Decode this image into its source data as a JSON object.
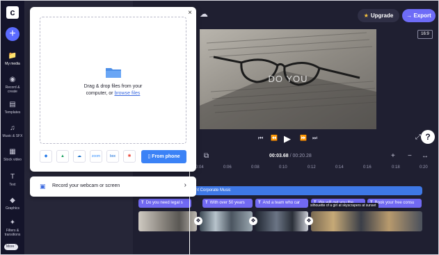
{
  "app": {
    "logo_letter": "c"
  },
  "sidebar": {
    "add_label": "+",
    "items": [
      {
        "label": "My media",
        "icon": "folder-icon"
      },
      {
        "label": "Record & create",
        "icon": "record-icon"
      },
      {
        "label": "Templates",
        "icon": "templates-icon"
      },
      {
        "label": "Music & SFX",
        "icon": "music-icon"
      },
      {
        "label": "Stock video",
        "icon": "film-icon"
      },
      {
        "label": "Text",
        "icon": "text-icon"
      },
      {
        "label": "Graphics",
        "icon": "shapes-icon"
      },
      {
        "label": "Filters & transitions",
        "icon": "wand-icon"
      }
    ],
    "more_label": "More"
  },
  "topbar": {
    "upgrade_label": "Upgrade",
    "export_label": "Export",
    "aspect_ratio": "16:9"
  },
  "preview": {
    "overlay_text": "DO YOU"
  },
  "timeline": {
    "current_time": "00:03.68",
    "separator": " / ",
    "total_time": "00:20.28",
    "ruler": [
      "0:04",
      "0:06",
      "0:08",
      "0:10",
      "0:12",
      "0:14",
      "0:16",
      "0:18",
      "0:20"
    ],
    "audio_track_label": "nt Corporate Music",
    "text_clips": [
      {
        "marker": "T",
        "label": "Do you need legal s"
      },
      {
        "marker": "T",
        "label": "With over 50 years"
      },
      {
        "marker": "T",
        "label": "And a team who car"
      },
      {
        "marker": "T",
        "label": "We will get you the"
      },
      {
        "marker": "T",
        "label": "Book your free consu"
      }
    ],
    "tooltip": "silhouette of a girl at skyscrapers at sunset"
  },
  "upload": {
    "close_label": "×",
    "drop_line1": "Drag & drop files from your",
    "drop_line2_prefix": "computer, or ",
    "browse_link": "browse files",
    "sources": [
      {
        "name": "dropbox-icon",
        "text": "◆"
      },
      {
        "name": "google-drive-icon",
        "text": "▲"
      },
      {
        "name": "onedrive-icon",
        "text": "☁"
      },
      {
        "name": "zoom-icon",
        "text": "zoom"
      },
      {
        "name": "box-icon",
        "text": "box"
      },
      {
        "name": "google-photos-icon",
        "text": "✱"
      }
    ],
    "from_phone_label": "From phone"
  },
  "record": {
    "label": "Record your webcam or screen"
  }
}
